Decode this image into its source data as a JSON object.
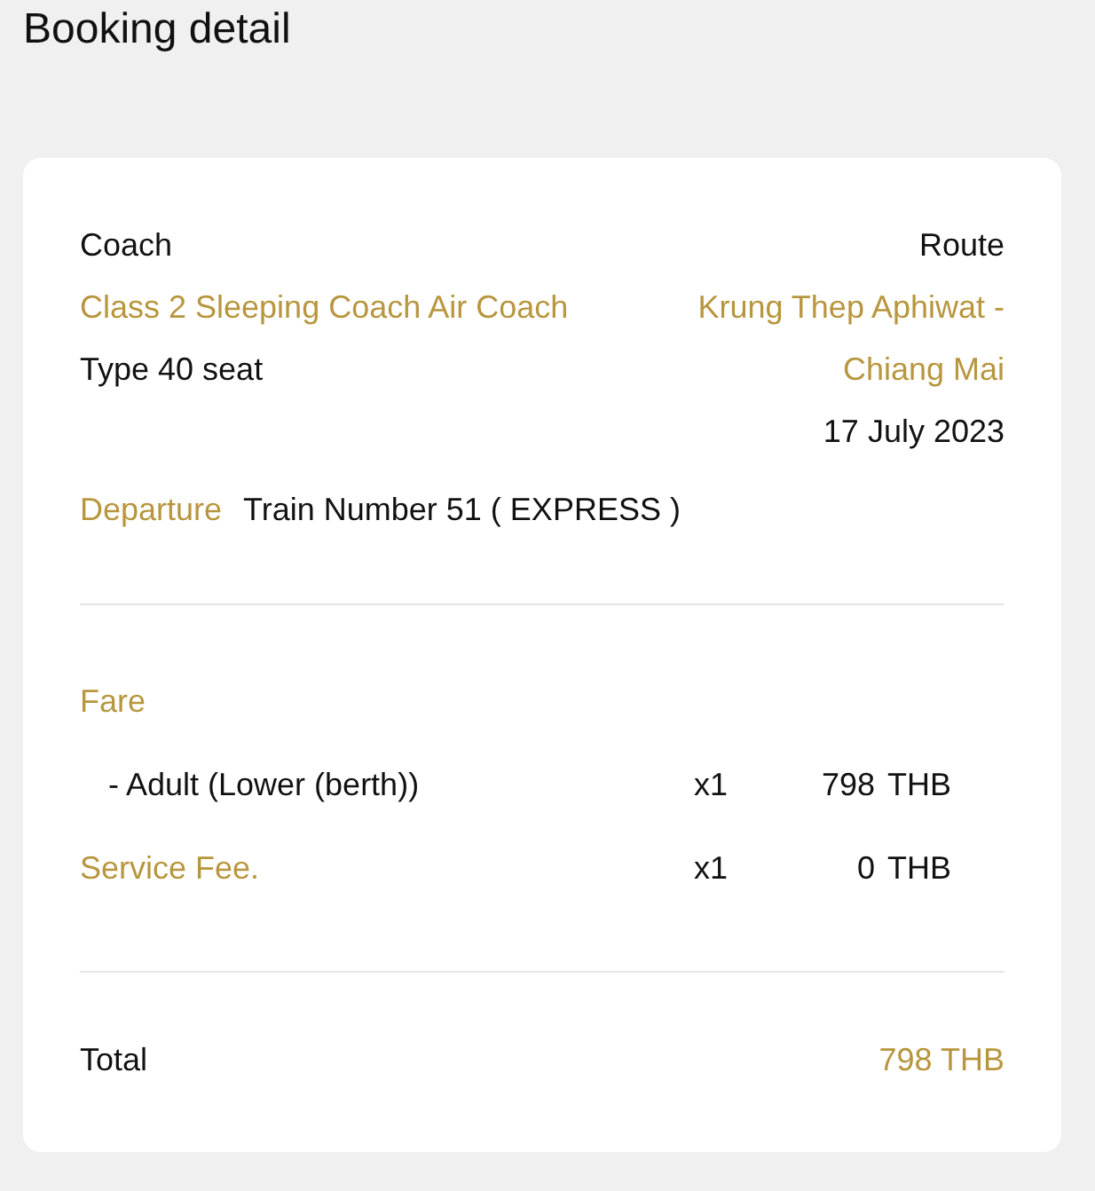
{
  "title": "Booking detail",
  "coach": {
    "label": "Coach",
    "name": "Class 2 Sleeping Coach Air Coach",
    "type": "Type 40 seat"
  },
  "route": {
    "label": "Route",
    "name": "Krung Thep Aphiwat - Chiang Mai",
    "date": "17 July 2023"
  },
  "departure": {
    "label": "Departure",
    "value": "Train Number 51 ( EXPRESS )"
  },
  "fare": {
    "label": "Fare",
    "lines": [
      {
        "kind": "passenger",
        "label": "- Adult (Lower (berth))",
        "qty": "x1",
        "amount": "798",
        "currency": "THB"
      },
      {
        "kind": "fee",
        "label": "Service Fee.",
        "qty": "x1",
        "amount": "0",
        "currency": "THB"
      }
    ]
  },
  "total": {
    "label": "Total",
    "value": "798 THB"
  }
}
